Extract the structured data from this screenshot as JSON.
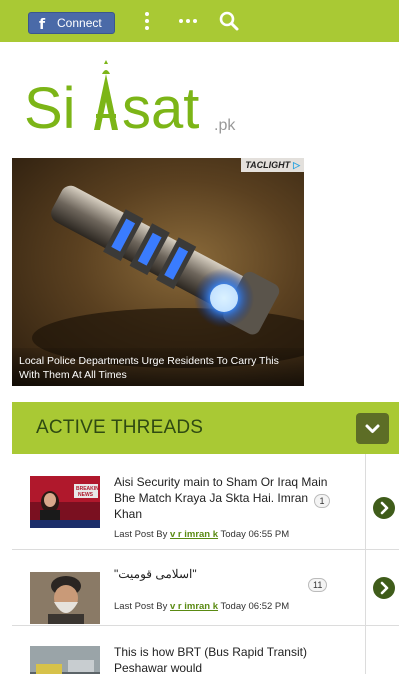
{
  "topbar": {
    "connect_label": "Connect",
    "facebook_glyph": "f",
    "icons": [
      "kebab-menu-icon",
      "more-icon",
      "search-icon"
    ],
    "bg_color": "#a9c934"
  },
  "logo": {
    "text_main": "Si",
    "text_rest": "sat",
    "text_suffix": ".pk",
    "brand_green": "#7cb517"
  },
  "ad": {
    "brand": "TACLIGHT",
    "caption": "Local Police Departments Urge Residents To Carry This With Them At All Times"
  },
  "active_threads": {
    "title": "ACTIVE THREADS",
    "threads": [
      {
        "title": "Aisi Security main to Sham Or Iraq Main Bhe Match Kraya Ja Skta Hai. Imran Khan",
        "last_post_prefix": "Last Post By",
        "user": "v r imran k",
        "time": "Today 06:55 PM",
        "count": "1"
      },
      {
        "title": "\"اسلامی قومیت\"",
        "last_post_prefix": "Last Post By",
        "user": "v r imran k",
        "time": "Today 06:52 PM",
        "count": "11"
      },
      {
        "title": "This is how BRT (Bus Rapid Transit) Peshawar would",
        "last_post_prefix": "",
        "user": "",
        "time": "",
        "count": ""
      }
    ]
  }
}
